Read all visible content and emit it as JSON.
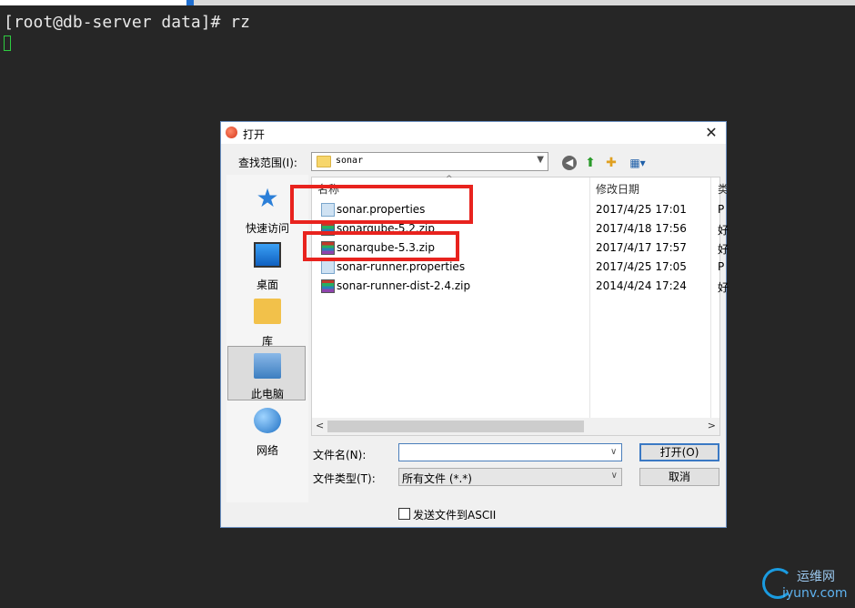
{
  "terminal": {
    "prompt_line": "[root@db-server data]# rz"
  },
  "dialog": {
    "title": "打开",
    "close_glyph": "✕",
    "lookin_label": "查找范围(I):",
    "lookin_value": "sonar",
    "places": [
      {
        "label": "快速访问",
        "icon": "star-icon"
      },
      {
        "label": "桌面",
        "icon": "desktop-icon"
      },
      {
        "label": "库",
        "icon": "library-icon"
      },
      {
        "label": "此电脑",
        "icon": "computer-icon",
        "selected": true
      },
      {
        "label": "网络",
        "icon": "network-icon"
      }
    ],
    "columns": {
      "name": "名称",
      "modified": "修改日期",
      "type": "类"
    },
    "files": [
      {
        "name": "sonar.properties",
        "modified": "2017/4/25 17:01",
        "type": "P",
        "kind": "properties"
      },
      {
        "name": "sonarqube-5.2.zip",
        "modified": "2017/4/18 17:56",
        "type": "好",
        "kind": "zip"
      },
      {
        "name": "sonarqube-5.3.zip",
        "modified": "2017/4/17 17:57",
        "type": "好",
        "kind": "zip"
      },
      {
        "name": "sonar-runner.properties",
        "modified": "2017/4/25 17:05",
        "type": "P",
        "kind": "properties"
      },
      {
        "name": "sonar-runner-dist-2.4.zip",
        "modified": "2014/4/24 17:24",
        "type": "好",
        "kind": "zip"
      }
    ],
    "filename_label": "文件名(N):",
    "filename_value": "",
    "filetype_label": "文件类型(T):",
    "filetype_value": "所有文件 (*.*)",
    "open_button": "打开(O)",
    "cancel_button": "取消",
    "ascii_checkbox_label": "发送文件到ASCII",
    "ascii_checked": false
  },
  "watermark": {
    "cn": "运维网",
    "en": "iyunv.com"
  },
  "colors": {
    "highlight_box": "#e8231e",
    "terminal_bg": "#262626",
    "accent": "#3b79c4"
  }
}
